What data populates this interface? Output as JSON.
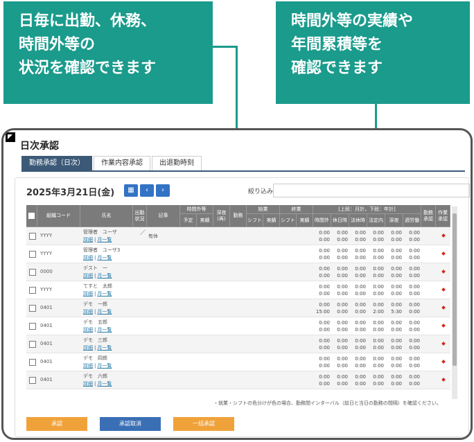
{
  "callouts": [
    {
      "lines": [
        "日毎に出勤、休務、",
        "時間外等の",
        "状況を確認できます"
      ]
    },
    {
      "lines": [
        "時間外等の実績や",
        "年間累積等を",
        "確認できます"
      ]
    }
  ],
  "window_title": "日次承認",
  "tabs": [
    "勤務承認（日次）",
    "作業内容承認",
    "出退勤時刻"
  ],
  "date": "2025年3月21日(金)",
  "filter_label": "絞り込み",
  "headers": {
    "code": "組織コード",
    "name": "氏名",
    "status": "出勤状況",
    "note": "記事",
    "overtime": "時間外等",
    "plan": "予定",
    "actual": "実績",
    "night": "深夜(再)",
    "rest": "勤務",
    "start": "始業",
    "end": "終業",
    "shift": "シフト",
    "actual2": "実績",
    "monthly": "[上段：月計，下段：年計]",
    "overtime2": "時間外",
    "holiday": "休日時",
    "legal": "法休時",
    "legal_in": "法定内",
    "deep": "深夜",
    "excess": "週労働",
    "approve1": "勤務承認",
    "approve2": "作業承認"
  },
  "links": {
    "detail": "詳細",
    "month": "月一覧"
  },
  "rows": [
    {
      "code": "YYYY",
      "name": "管理者　ユーザ",
      "slash": "／",
      "note": "有休",
      "upper": [
        "0:00",
        "0:00",
        "0:00",
        "0:00",
        "0:00",
        "0:00"
      ],
      "lower": [
        "0:00",
        "0:00",
        "0:00",
        "0:00",
        "0:00",
        "0:00"
      ]
    },
    {
      "code": "YYYY",
      "name": "管理者　ユーザ3",
      "upper": [
        "0:00",
        "0:00",
        "0:00",
        "0:00",
        "0:00",
        "0:00"
      ],
      "lower": [
        "0:00",
        "0:00",
        "0:00",
        "0:00",
        "0:00",
        "0:00"
      ]
    },
    {
      "code": "0000",
      "name": "デスト　一",
      "upper": [
        "0:00",
        "0:00",
        "0:00",
        "0:00",
        "0:00",
        "0:00"
      ],
      "lower": [
        "0:00",
        "0:00",
        "0:00",
        "0:00",
        "0:00",
        "0:00"
      ]
    },
    {
      "code": "YYYY",
      "name": "てすと　太郎",
      "upper": [
        "0:00",
        "0:00",
        "0:00",
        "0:00",
        "0:00",
        "0:00"
      ],
      "lower": [
        "0:00",
        "0:00",
        "0:00",
        "0:00",
        "0:00",
        "0:00"
      ]
    },
    {
      "code": "0401",
      "name": "デモ　一郎",
      "upper": [
        "0:00",
        "0:00",
        "0:00",
        "0:00",
        "0:00",
        "0:00"
      ],
      "lower": [
        "15:00",
        "0:00",
        "0:00",
        "2:00",
        "5:30",
        "0:00"
      ]
    },
    {
      "code": "0401",
      "name": "デモ　五郎",
      "upper": [
        "0:00",
        "0:00",
        "0:00",
        "0:00",
        "0:00",
        "0:00"
      ],
      "lower": [
        "0:00",
        "0:00",
        "0:00",
        "0:00",
        "0:00",
        "0:00"
      ]
    },
    {
      "code": "0401",
      "name": "デモ　三郎",
      "upper": [
        "0:00",
        "0:00",
        "0:00",
        "0:00",
        "0:00",
        "0:00"
      ],
      "lower": [
        "0:00",
        "0:00",
        "0:00",
        "0:00",
        "0:00",
        "0:00"
      ]
    },
    {
      "code": "0401",
      "name": "デモ　四郎",
      "upper": [
        "0:00",
        "0:00",
        "0:00",
        "0:00",
        "0:00",
        "0:00"
      ],
      "lower": [
        "0:00",
        "0:00",
        "0:00",
        "0:00",
        "0:00",
        "0:00"
      ]
    },
    {
      "code": "0401",
      "name": "デモ　六郎",
      "upper": [
        "0:00",
        "0:00",
        "0:00",
        "0:00",
        "0:00",
        "0:00"
      ],
      "lower": [
        "0:00",
        "0:00",
        "0:00",
        "0:00",
        "0:00",
        "0:00"
      ]
    }
  ],
  "footnote": "・就業・シフトの色分けが色の場合、勤務間インターバル（前日と当日の勤務の間隔）を確認ください。",
  "actions": {
    "approve": "承認",
    "cancel": "承認取消",
    "bulk": "一括承認"
  },
  "icons": {
    "calendar": "calendar-icon",
    "prev": "chevron-left-icon",
    "next": "chevron-right-icon",
    "status_mark": "diamond-icon"
  },
  "colors": {
    "callout": "#1a9b8c",
    "tab_active": "#3c5a78",
    "nav": "#3273c5",
    "approve": "#f0a23a",
    "cancel": "#3a6fb5",
    "bulk": "#f0a23a",
    "mark": "#d9261c"
  }
}
